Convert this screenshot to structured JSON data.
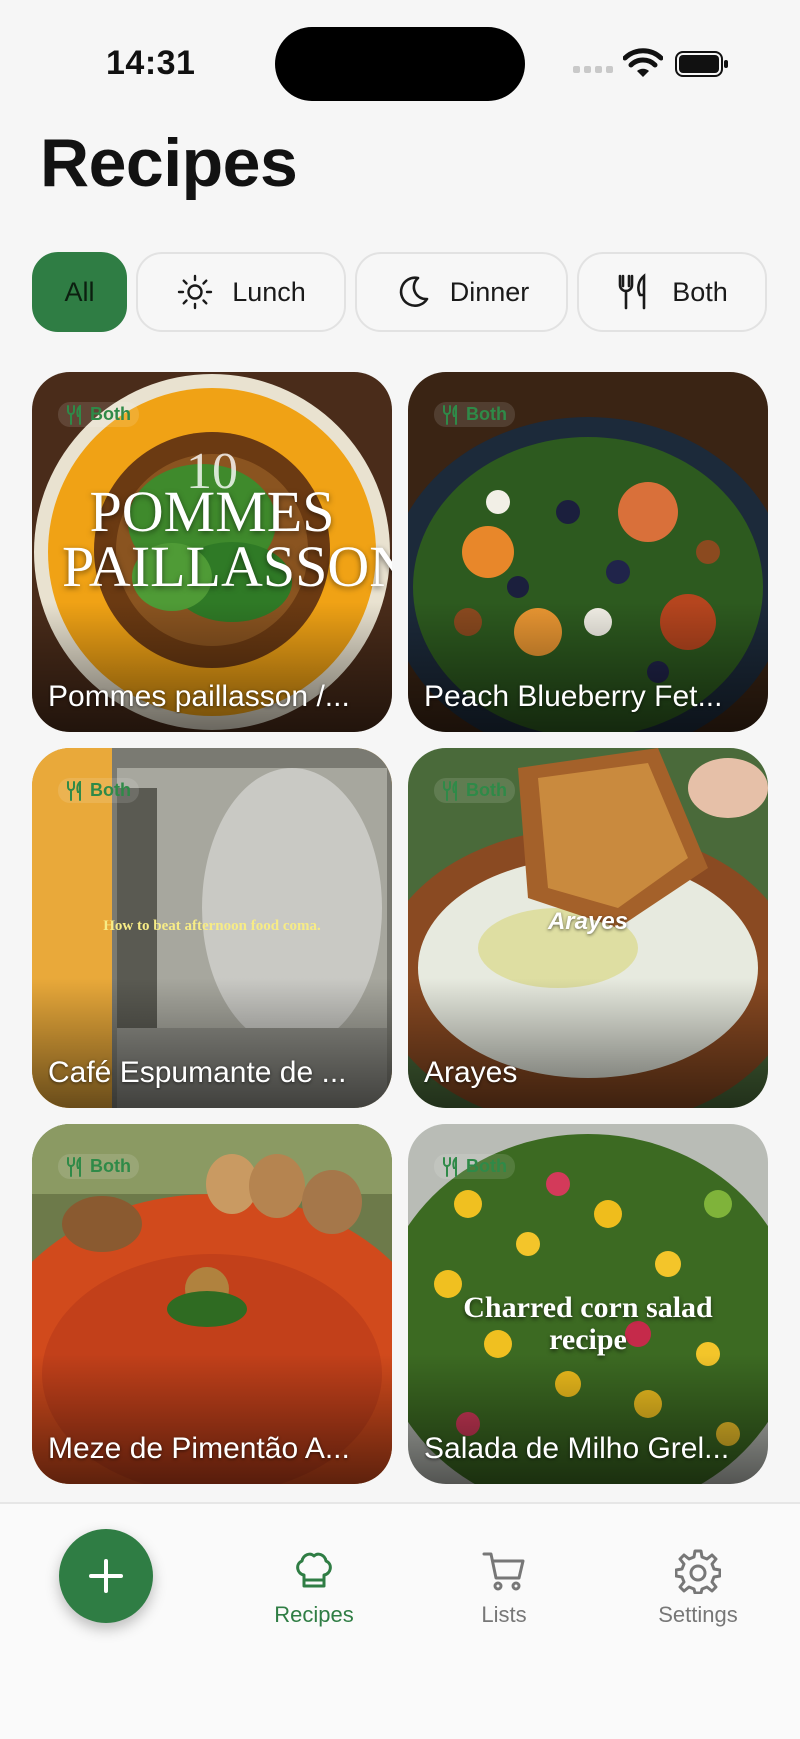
{
  "status_bar": {
    "time": "14:31"
  },
  "page": {
    "title": "Recipes"
  },
  "filters": [
    {
      "label": "All",
      "icon": "none",
      "active": true
    },
    {
      "label": "Lunch",
      "icon": "sun-icon",
      "active": false
    },
    {
      "label": "Dinner",
      "icon": "moon-icon",
      "active": false
    },
    {
      "label": "Both",
      "icon": "fork-knife-icon",
      "active": false
    }
  ],
  "recipes": [
    {
      "title": "Pommes paillasson /...",
      "badge": "Both",
      "overlay": "POMMES PAILLASSON",
      "overlay_small": "10"
    },
    {
      "title": "Peach Blueberry Fet...",
      "badge": "Both",
      "overlay": ""
    },
    {
      "title": "Café Espumante de ...",
      "badge": "Both",
      "overlay": "How to beat afternoon food coma."
    },
    {
      "title": "Arayes",
      "badge": "Both",
      "overlay": "Arayes"
    },
    {
      "title": "Meze de Pimentão A...",
      "badge": "Both",
      "overlay": ""
    },
    {
      "title": "Salada de Milho Grel...",
      "badge": "Both",
      "overlay": "Charred corn salad recipe"
    }
  ],
  "tab_bar": {
    "add_icon": "plus-icon",
    "tabs": [
      {
        "label": "Recipes",
        "icon": "chef-hat-icon",
        "active": true
      },
      {
        "label": "Lists",
        "icon": "cart-icon",
        "active": false
      },
      {
        "label": "Settings",
        "icon": "gear-icon",
        "active": false
      }
    ]
  },
  "colors": {
    "accent": "#2f7d44",
    "background": "#f6f6f6",
    "badge": "#2f8a48"
  }
}
